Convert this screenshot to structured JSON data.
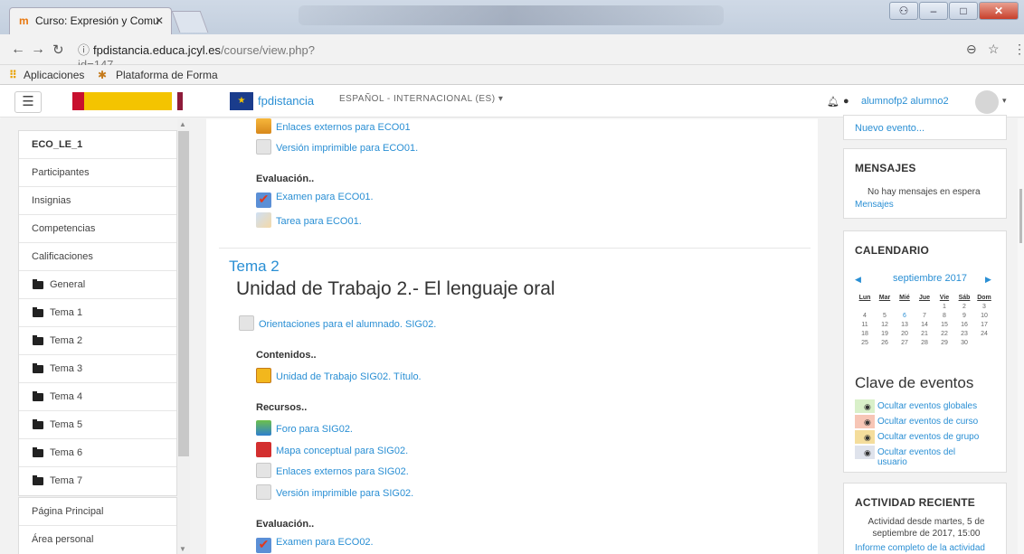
{
  "browser": {
    "tab_title": "Curso: Expresión y Comu",
    "url_host": "fpdistancia.educa.jcyl.es",
    "url_path": "/course/view.php?id=147",
    "bookmark_apps": "Aplicaciones",
    "bookmark_platform": "Plataforma de Forma"
  },
  "header": {
    "site_name": "fpdistancia",
    "language": "ESPAÑOL - INTERNACIONAL (ES) ▾",
    "user": "alumnofp2 alumno2",
    "logo_gobierno": "GOBIERNO DE ESPAÑA · MINISTERIO DE EDUCACIÓN, CULTURA Y DEPORTE",
    "logo_junta": "Junta de Castilla y León"
  },
  "nav": {
    "course": "ECO_LE_1",
    "items": [
      "Participantes",
      "Insignias",
      "Competencias",
      "Calificaciones"
    ],
    "sections": [
      "General",
      "Tema 1",
      "Tema 2",
      "Tema 3",
      "Tema 4",
      "Tema 5",
      "Tema 6",
      "Tema 7"
    ],
    "bottom": [
      "Página Principal",
      "Área personal"
    ]
  },
  "main": {
    "top_links": [
      "Enlaces externos para ECO01",
      "Versión imprimible para ECO01."
    ],
    "eval1_title": "Evaluación..",
    "eval1_links": [
      "Examen para ECO01.",
      "Tarea para ECO01."
    ],
    "section_title": "Tema 2",
    "unit_title": "Unidad de Trabajo 2.- El lenguaje oral",
    "orient": "Orientaciones para el alumnado. SIG02.",
    "contenidos_title": "Contenidos..",
    "contenidos_link": "Unidad de Trabajo SIG02. Título.",
    "recursos_title": "Recursos..",
    "recursos_links": [
      "Foro para SIG02.",
      "Mapa conceptual para SIG02.",
      "Enlaces externos para SIG02.",
      "Versión imprimible para SIG02."
    ],
    "eval2_title": "Evaluación..",
    "eval2_link": "Examen para ECO02."
  },
  "right": {
    "new_event": "Nuevo evento...",
    "messages_title": "MENSAJES",
    "messages_text": "No hay mensajes en espera",
    "messages_link": "Mensajes",
    "calendar_title": "CALENDARIO",
    "calendar_month": "septiembre 2017",
    "calendar_days": [
      "Lun",
      "Mar",
      "Mié",
      "Jue",
      "Vie",
      "Sáb",
      "Dom"
    ],
    "calendar_weeks": [
      [
        "",
        "",
        "",
        "",
        "1",
        "2",
        "3"
      ],
      [
        "4",
        "5",
        "6",
        "7",
        "8",
        "9",
        "10"
      ],
      [
        "11",
        "12",
        "13",
        "14",
        "15",
        "16",
        "17"
      ],
      [
        "18",
        "19",
        "20",
        "21",
        "22",
        "23",
        "24"
      ],
      [
        "25",
        "26",
        "27",
        "28",
        "29",
        "30",
        ""
      ]
    ],
    "legend_title": "Clave de eventos",
    "legend": [
      {
        "label": "Ocultar eventos globales",
        "color": "#d9f0c9"
      },
      {
        "label": "Ocultar eventos de curso",
        "color": "#f7c6b6"
      },
      {
        "label": "Ocultar eventos de grupo",
        "color": "#f4dd9c"
      },
      {
        "label": "Ocultar eventos del usuario",
        "color": "#dfe3ec"
      }
    ],
    "activity_title": "ACTIVIDAD RECIENTE",
    "activity_text": "Actividad desde martes, 5 de septiembre de 2017, 15:00",
    "activity_link": "Informe completo de la actividad"
  }
}
